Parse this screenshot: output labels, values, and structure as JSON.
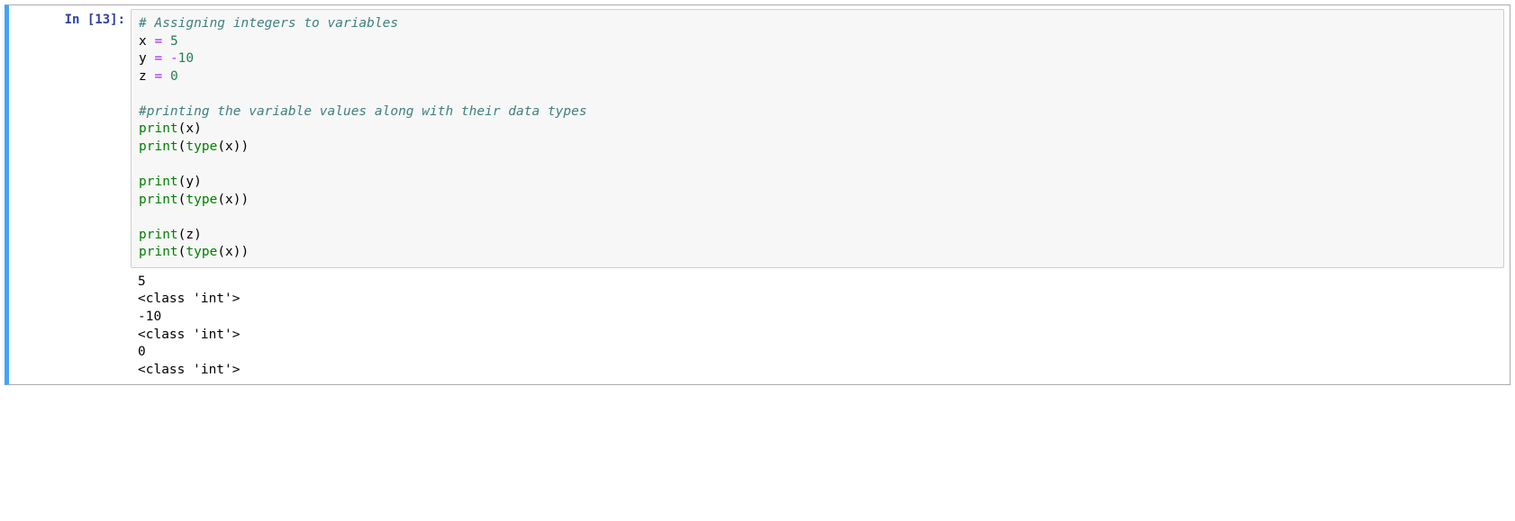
{
  "cell": {
    "prompt_prefix": "In [",
    "exec_count": "13",
    "prompt_suffix": "]:",
    "code": {
      "l0_comment": "# Assigning integers to variables",
      "l1_a": "x",
      "l1_b": " = ",
      "l1_c": "5",
      "l2_a": "y",
      "l2_b": " = ",
      "l2_c": "-",
      "l2_d": "10",
      "l3_a": "z",
      "l3_b": " = ",
      "l3_c": "0",
      "l5_comment": "#printing the variable values along with their data types",
      "l6_a": "print",
      "l6_b": "(x)",
      "l7_a": "print",
      "l7_b": "(",
      "l7_c": "type",
      "l7_d": "(x))",
      "l9_a": "print",
      "l9_b": "(y)",
      "l10_a": "print",
      "l10_b": "(",
      "l10_c": "type",
      "l10_d": "(x))",
      "l12_a": "print",
      "l12_b": "(z)",
      "l13_a": "print",
      "l13_b": "(",
      "l13_c": "type",
      "l13_d": "(x))"
    },
    "output": "5\n<class 'int'>\n-10\n<class 'int'>\n0\n<class 'int'>"
  }
}
